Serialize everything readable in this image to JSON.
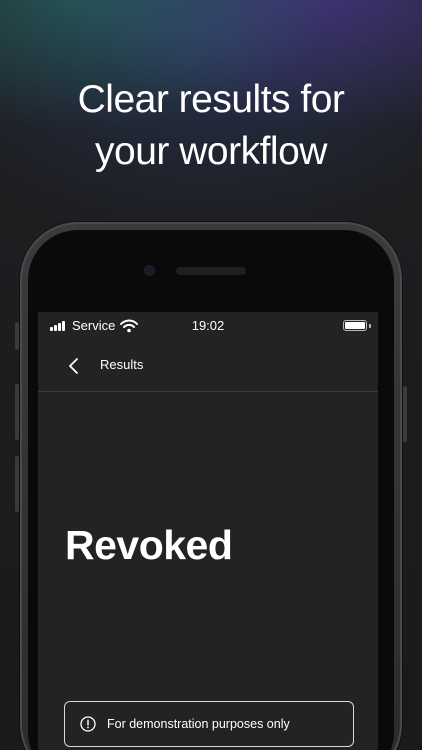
{
  "headline": {
    "line1": "Clear results for",
    "line2": "your workflow"
  },
  "status_bar": {
    "carrier": "Service",
    "time": "19:02",
    "icons": [
      "signal-icon",
      "wifi-icon",
      "battery-icon"
    ]
  },
  "nav": {
    "back_icon": "chevron-left-icon",
    "title": "Results"
  },
  "result": {
    "status": "Revoked"
  },
  "disclaimer": {
    "icon": "info-circle-icon",
    "text": "For demonstration purposes only"
  },
  "colors": {
    "screen_background": "#232324",
    "page_background": "#1c1c1e",
    "text": "#ffffff",
    "divider": "#3a3a3c"
  }
}
